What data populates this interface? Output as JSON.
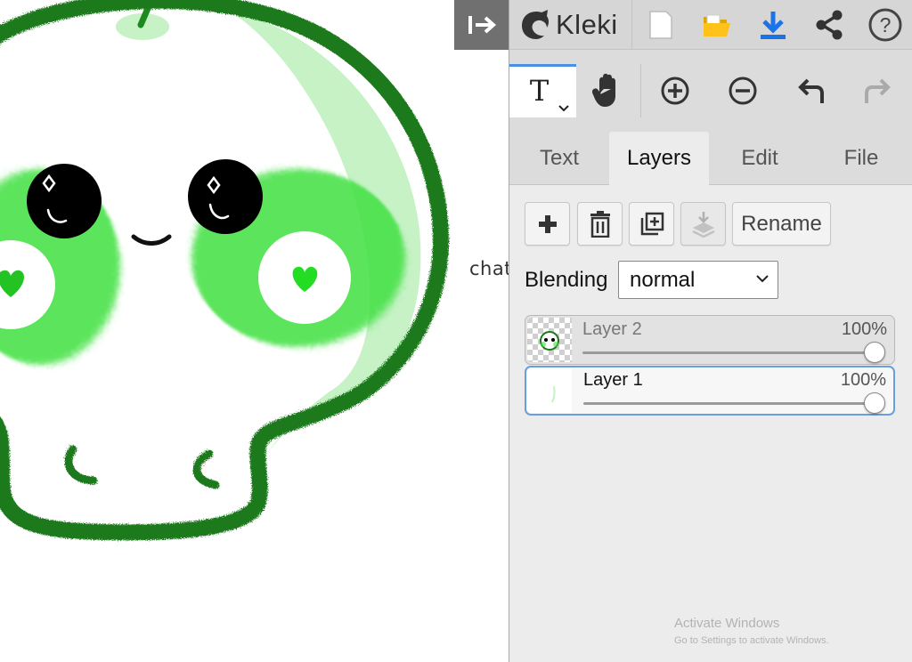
{
  "canvas": {
    "text_fragment": "chat",
    "colors": {
      "outline": "#1a7a1a",
      "blush": "#3ee03e",
      "fill_light": "#c6f2c6",
      "eye": "#000000"
    }
  },
  "toolbar": {
    "collapse_icon": "collapse-panel-arrow-icon",
    "logo_text": "Kleki",
    "buttons": [
      "new-image-icon",
      "open-folder-icon",
      "download-icon",
      "share-icon",
      "help-icon"
    ],
    "accent_color": "#1a73e8"
  },
  "tools": {
    "active_tool_label": "T",
    "items": [
      "text-tool",
      "hand-tool",
      "zoom-in-icon",
      "zoom-out-icon",
      "undo-icon",
      "redo-icon"
    ]
  },
  "tabs": [
    {
      "label": "Text"
    },
    {
      "label": "Layers"
    },
    {
      "label": "Edit"
    },
    {
      "label": "File"
    }
  ],
  "layers_panel": {
    "buttons": {
      "add": "add-layer-icon",
      "delete": "delete-layer-icon",
      "duplicate": "duplicate-layer-icon",
      "merge": "merge-down-icon",
      "rename_label": "Rename"
    },
    "blending_label": "Blending",
    "blending_value": "normal",
    "layers": [
      {
        "name": "Layer 2",
        "opacity": "100%",
        "opacity_value": 100,
        "selected": false
      },
      {
        "name": "Layer 1",
        "opacity": "100%",
        "opacity_value": 100,
        "selected": true
      }
    ]
  },
  "watermark": {
    "line1": "Activate Windows",
    "line2": "Go to Settings to activate Windows."
  }
}
